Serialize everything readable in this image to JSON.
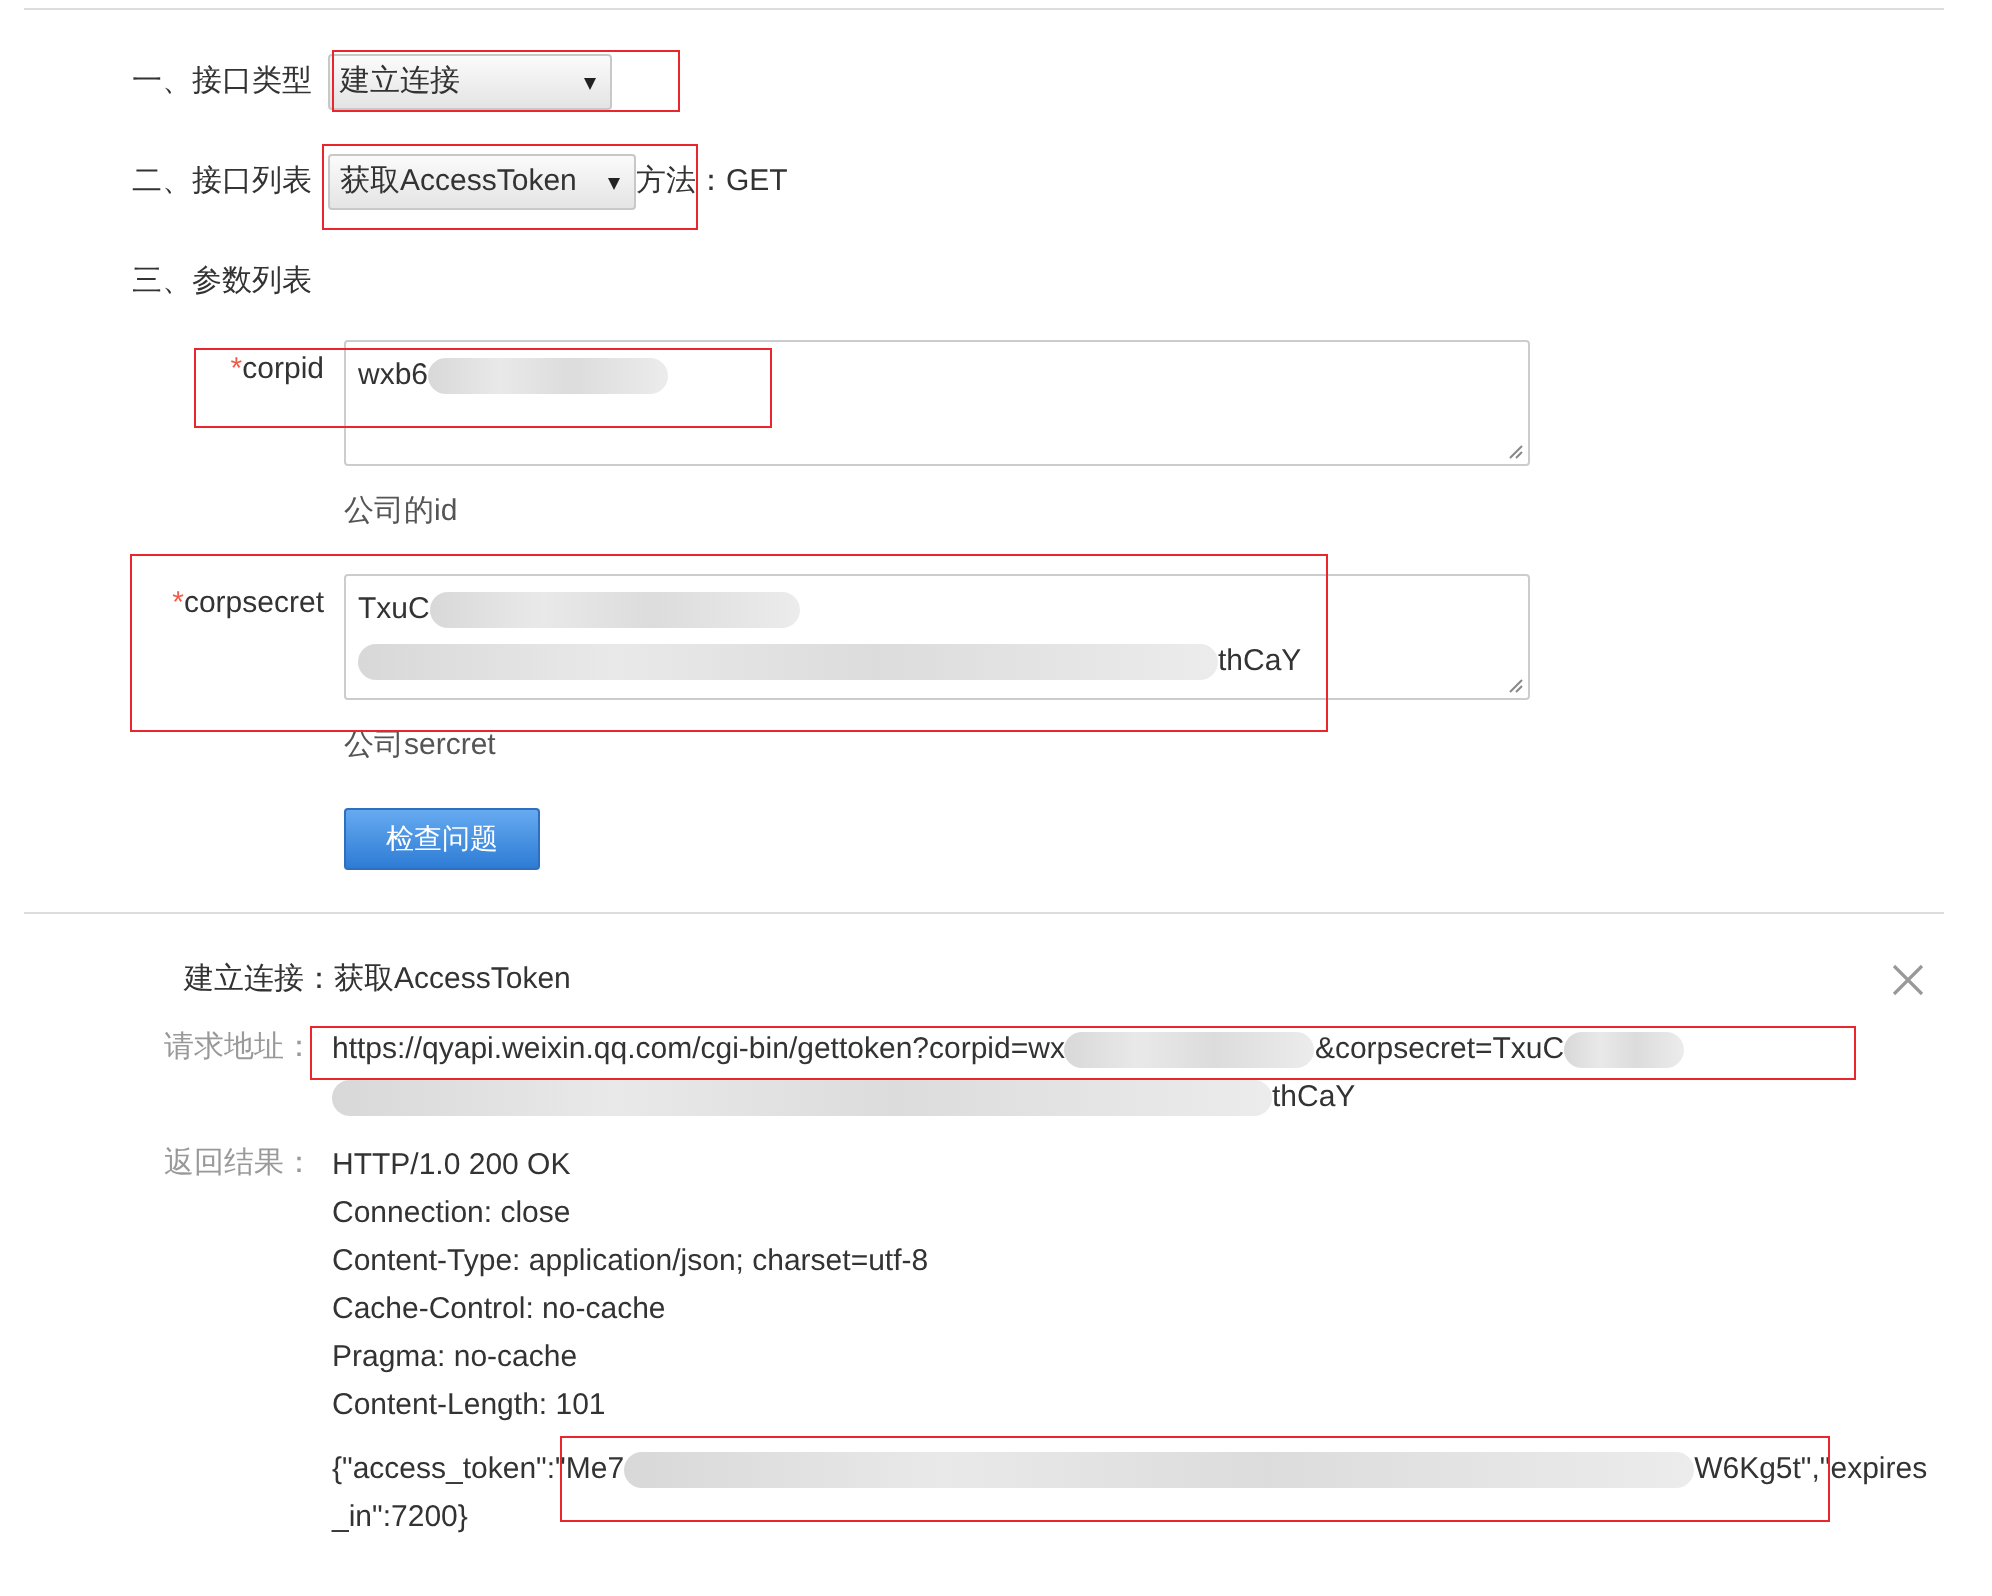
{
  "form": {
    "type_row": {
      "label": "一、接口类型",
      "select": "建立连接",
      "highlighted": true
    },
    "api_row": {
      "label": "二、接口列表",
      "select": "获取AccessToken",
      "highlighted": true,
      "method": "方法：GET"
    },
    "params_heading": "三、参数列表",
    "params": [
      {
        "mark": "*",
        "label": "corpid",
        "highlighted": true,
        "value": [
          {
            "kind": "text",
            "text": "wxb6"
          },
          {
            "kind": "blur"
          }
        ],
        "hint": "公司的id"
      },
      {
        "mark": "*",
        "label": "corpsecret",
        "highlighted": true,
        "value": [
          {
            "kind": "text",
            "text": "TxuC"
          },
          {
            "kind": "blur"
          },
          {
            "kind": "blur"
          },
          {
            "kind": "text",
            "text": "thCaY"
          }
        ],
        "hint": "公司sercret"
      }
    ],
    "button": "检查问题"
  },
  "result": {
    "title": "建立连接：获取AccessToken",
    "request": {
      "label": "请求地址：",
      "highlighted": true,
      "value": [
        {
          "kind": "text",
          "text": "https://qyapi.weixin.qq.com/cgi-bin/gettoken?corpid=wx"
        },
        {
          "kind": "blur"
        },
        {
          "kind": "text",
          "text": "&corpsecret=TxuC"
        },
        {
          "kind": "blur"
        },
        {
          "kind": "blur"
        },
        {
          "kind": "text",
          "text": "thCaY"
        }
      ]
    },
    "response": {
      "label": "返回结果：",
      "lines": [
        "HTTP/1.0 200 OK",
        "Connection: close",
        "Content-Type: application/json; charset=utf-8",
        "Cache-Control: no-cache",
        "Pragma: no-cache",
        "Content-Length: 101"
      ],
      "body": {
        "highlighted": true,
        "value": [
          {
            "kind": "text",
            "text": "{\"access_token\":\"Me7"
          },
          {
            "kind": "blur"
          },
          {
            "kind": "text",
            "text": "W6Kg5t\",\"expires_in\":7200}"
          }
        ]
      }
    }
  }
}
